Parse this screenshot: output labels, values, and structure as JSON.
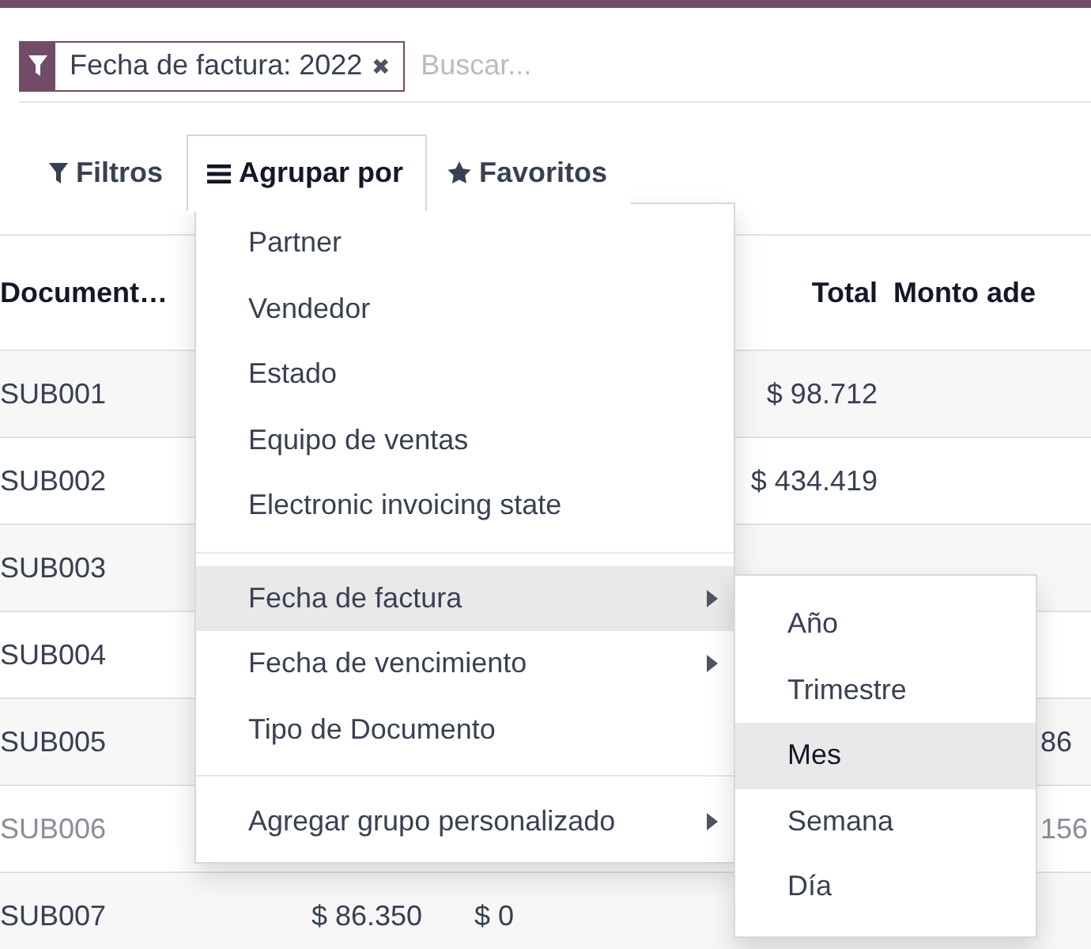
{
  "search": {
    "facet": {
      "label": "Fecha de factura: 2022",
      "remove": "✖"
    },
    "placeholder": "Buscar..."
  },
  "tabs": [
    {
      "label": "Filtros",
      "selected": false
    },
    {
      "label": "Agrupar por",
      "selected": true
    },
    {
      "label": "Favoritos",
      "selected": false
    }
  ],
  "table": {
    "columns": [
      "Document…",
      "",
      "",
      "Total",
      "Monto ade"
    ],
    "rows": [
      {
        "muted": false,
        "cells": [
          "SUB001",
          "",
          "",
          "$ 98.712",
          ""
        ]
      },
      {
        "muted": false,
        "cells": [
          "SUB002",
          "",
          "",
          "$ 434.419",
          ""
        ]
      },
      {
        "muted": false,
        "cells": [
          "SUB003",
          "",
          "",
          "",
          ""
        ]
      },
      {
        "muted": false,
        "cells": [
          "SUB004",
          "",
          "",
          "",
          ""
        ]
      },
      {
        "muted": false,
        "cells": [
          "SUB005",
          "",
          "",
          "",
          "86"
        ]
      },
      {
        "muted": true,
        "cells": [
          "SUB006",
          "",
          "",
          "",
          "156"
        ]
      },
      {
        "muted": false,
        "cells": [
          "SUB007",
          "$ 86.350",
          "$ 0",
          "",
          ""
        ]
      }
    ]
  },
  "group_menu": {
    "sections": [
      [
        {
          "label": "Partner",
          "submenu": false,
          "highlighted": false
        },
        {
          "label": "Vendedor",
          "submenu": false,
          "highlighted": false
        },
        {
          "label": "Estado",
          "submenu": false,
          "highlighted": false
        },
        {
          "label": "Equipo de ventas",
          "submenu": false,
          "highlighted": false
        },
        {
          "label": "Electronic invoicing state",
          "submenu": false,
          "highlighted": false
        }
      ],
      [
        {
          "label": "Fecha de factura",
          "submenu": true,
          "highlighted": true
        },
        {
          "label": "Fecha de vencimiento",
          "submenu": true,
          "highlighted": false
        },
        {
          "label": "Tipo de Documento",
          "submenu": false,
          "highlighted": false
        }
      ],
      [
        {
          "label": "Agregar grupo personalizado",
          "submenu": true,
          "highlighted": false
        }
      ]
    ]
  },
  "submenu": {
    "items": [
      {
        "label": "Año",
        "highlighted": false
      },
      {
        "label": "Trimestre",
        "highlighted": false
      },
      {
        "label": "Mes",
        "highlighted": true
      },
      {
        "label": "Semana",
        "highlighted": false
      },
      {
        "label": "Día",
        "highlighted": false
      }
    ]
  }
}
